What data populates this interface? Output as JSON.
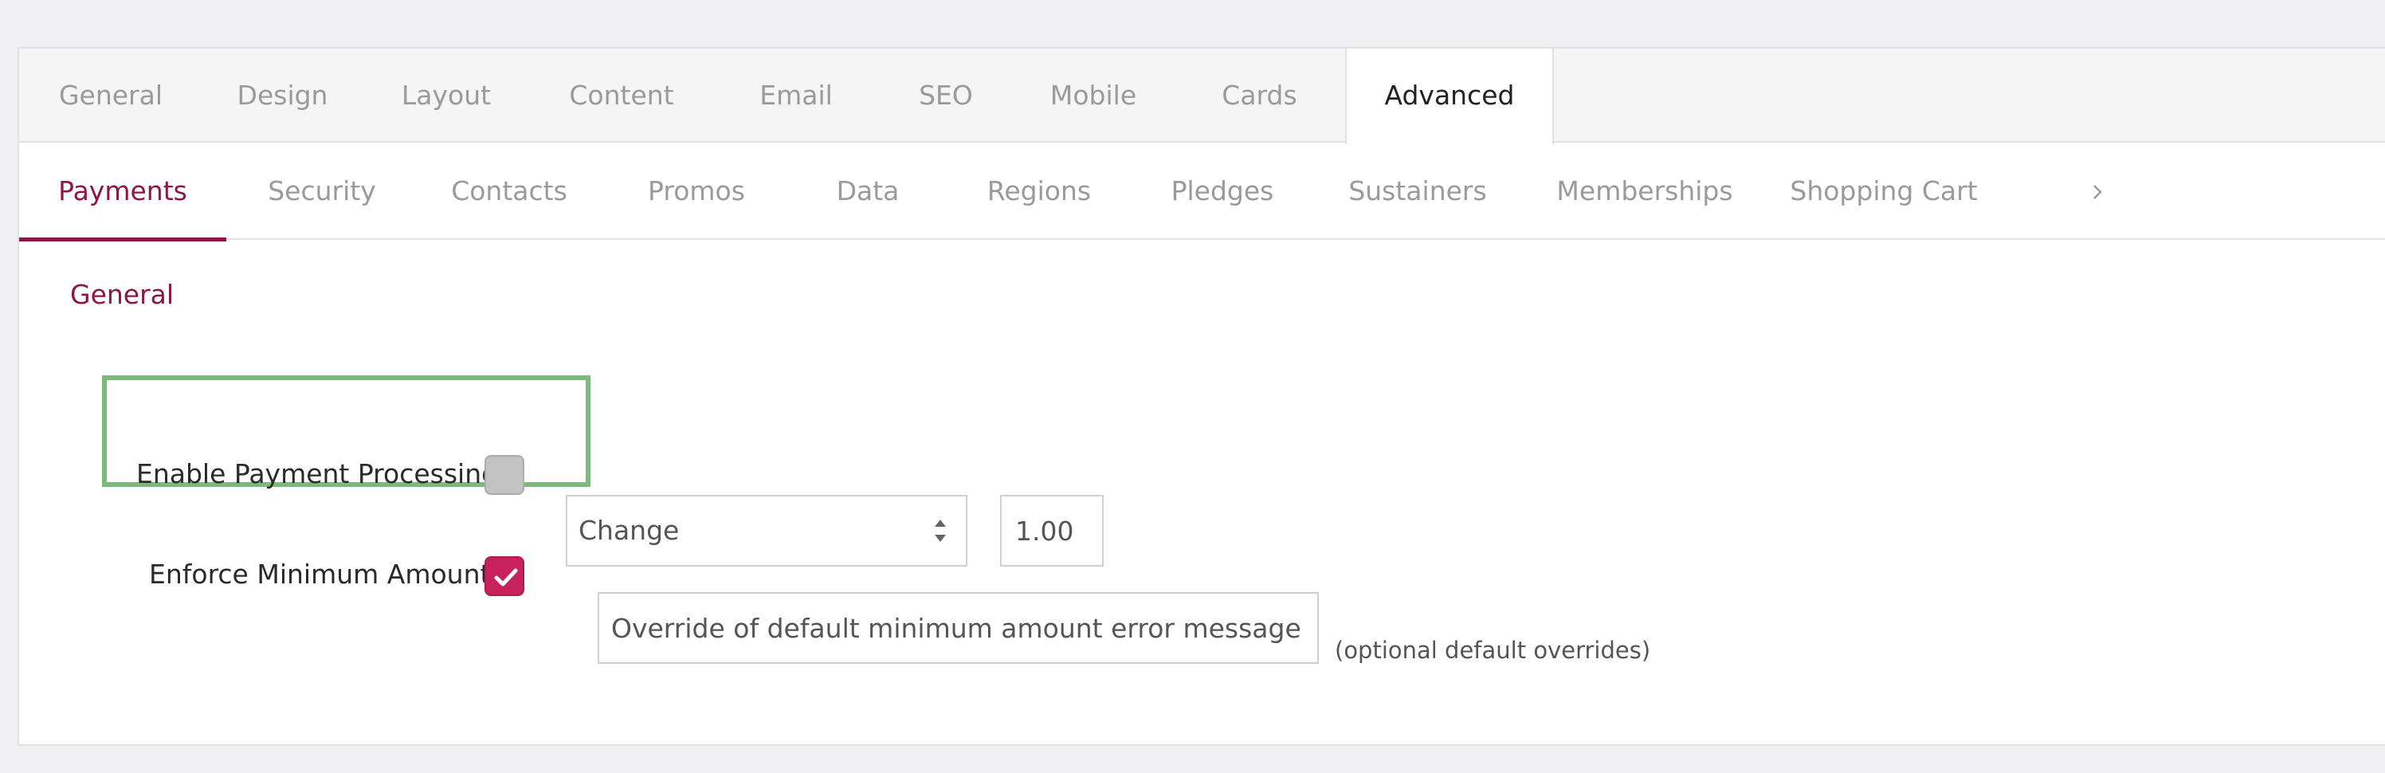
{
  "top_tabs": [
    {
      "label": "General",
      "active": false
    },
    {
      "label": "Design",
      "active": false
    },
    {
      "label": "Layout",
      "active": false
    },
    {
      "label": "Content",
      "active": false
    },
    {
      "label": "Email",
      "active": false
    },
    {
      "label": "SEO",
      "active": false
    },
    {
      "label": "Mobile",
      "active": false
    },
    {
      "label": "Cards",
      "active": false
    },
    {
      "label": "Advanced",
      "active": true
    }
  ],
  "sub_tabs": [
    {
      "label": "Payments",
      "active": true
    },
    {
      "label": "Security",
      "active": false
    },
    {
      "label": "Contacts",
      "active": false
    },
    {
      "label": "Promos",
      "active": false
    },
    {
      "label": "Data",
      "active": false
    },
    {
      "label": "Regions",
      "active": false
    },
    {
      "label": "Pledges",
      "active": false
    },
    {
      "label": "Sustainers",
      "active": false
    },
    {
      "label": "Memberships",
      "active": false
    },
    {
      "label": "Shopping Cart",
      "active": false
    }
  ],
  "sub_tabs_more_icon": "chevron-right-icon",
  "section": {
    "title": "General"
  },
  "fields": {
    "enable_payment_processing": {
      "label": "Enable Payment Processing",
      "checked": false
    },
    "enforce_minimum_amount": {
      "label": "Enforce Minimum Amount",
      "checked": true,
      "select_value": "Change",
      "amount_value": "1.00",
      "message_placeholder": "Override of default minimum amount error message",
      "message_hint": "(optional default overrides)"
    }
  },
  "colors": {
    "accent": "#8c1746",
    "checkbox_on": "#c8225c",
    "checkbox_off": "#c2c2c2",
    "highlight": "#7dba7a"
  }
}
